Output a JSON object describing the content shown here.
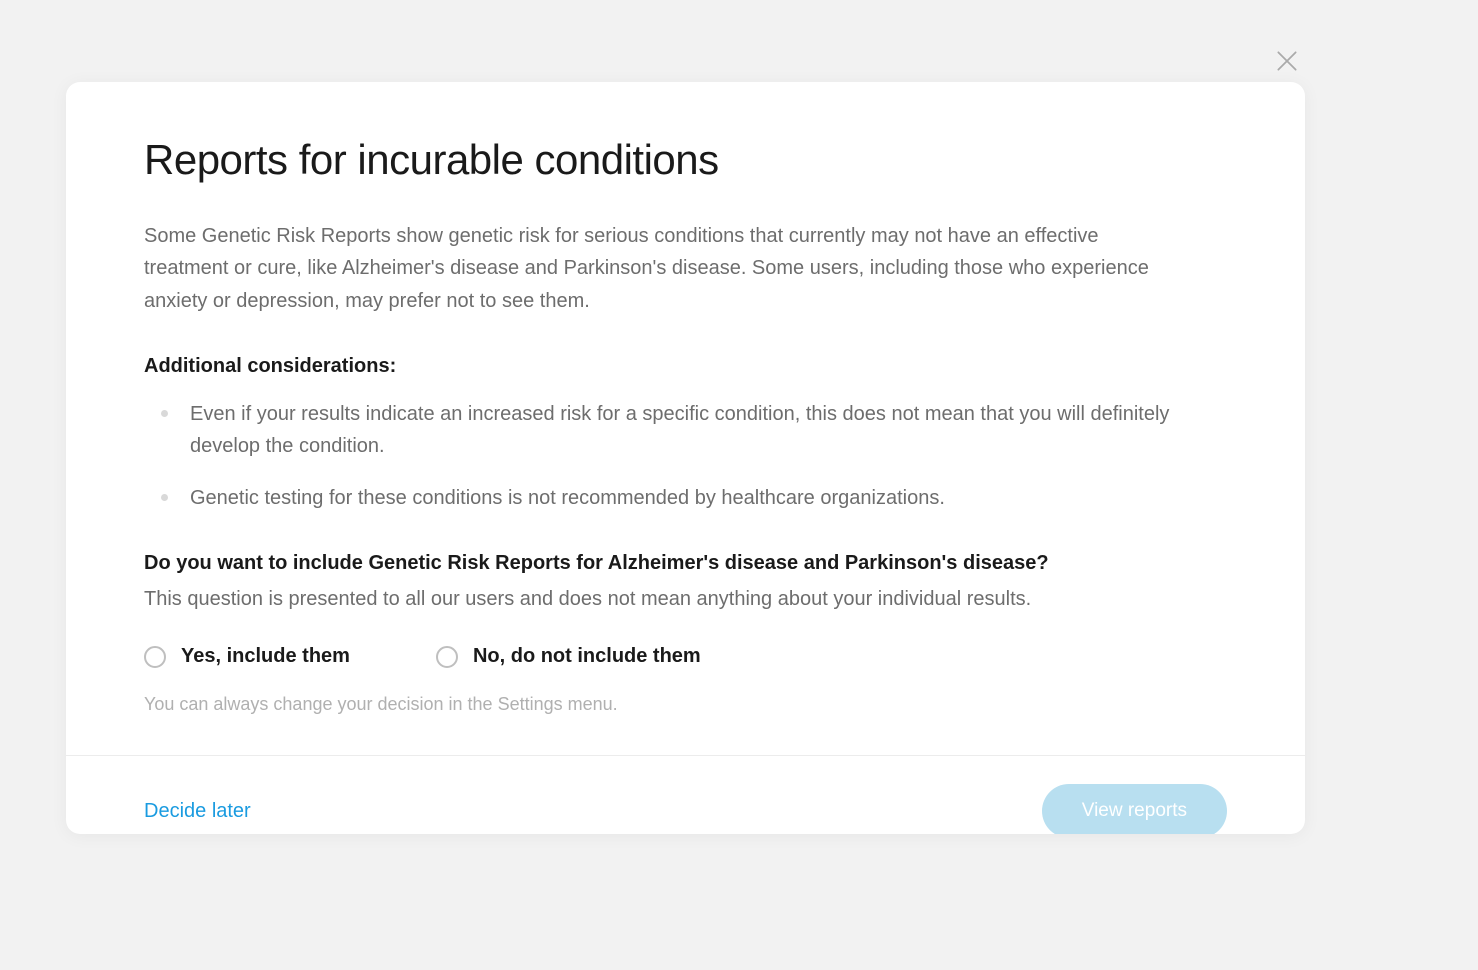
{
  "modal": {
    "title": "Reports for incurable conditions",
    "intro": "Some Genetic Risk Reports show genetic risk for serious conditions that currently may not have an effective treatment or cure, like Alzheimer's disease and Parkinson's disease. Some users, including those who experience anxiety or depression, may prefer not to see them.",
    "considerations_heading": "Additional considerations:",
    "considerations": [
      "Even if your results indicate an increased risk for a specific condition, this does not mean that you will definitely develop the condition.",
      "Genetic testing for these conditions is not recommended by healthcare organizations."
    ],
    "question": "Do you want to include Genetic Risk Reports for Alzheimer's disease and Parkinson's disease?",
    "question_note": "This question is presented to all our users and does not mean anything about your individual results.",
    "options": {
      "yes": "Yes, include them",
      "no": "No, do not include them"
    },
    "change_note": "You can always change your decision in the Settings menu.",
    "footer": {
      "decide_later": "Decide later",
      "view_reports": "View reports"
    }
  }
}
